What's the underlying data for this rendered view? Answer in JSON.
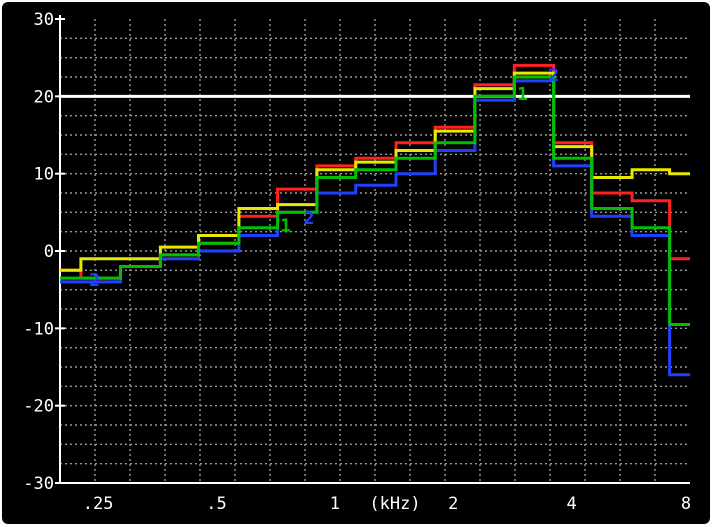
{
  "chart_data": {
    "type": "line",
    "step": true,
    "x_scale": "log2",
    "xlim": [
      0.2,
      8
    ],
    "ylim": [
      -30,
      30
    ],
    "grid": true,
    "background": "#000000",
    "xlabel": "(kHz)",
    "x_ticks": [
      {
        "value": 0.25,
        "label": ".25"
      },
      {
        "value": 0.5,
        "label": ".5"
      },
      {
        "value": 1,
        "label": "1"
      },
      {
        "value": 2,
        "label": "2"
      },
      {
        "value": 4,
        "label": "4"
      },
      {
        "value": 8,
        "label": "8"
      }
    ],
    "y_ticks": [
      {
        "value": 30,
        "label": "30"
      },
      {
        "value": 20,
        "label": "20"
      },
      {
        "value": 10,
        "label": "10"
      },
      {
        "value": 0,
        "label": "0"
      },
      {
        "value": -10,
        "label": "-10"
      },
      {
        "value": -20,
        "label": "-20"
      },
      {
        "value": -30,
        "label": "-30"
      }
    ],
    "reference_line": {
      "y": 20,
      "color": "#ffffff"
    },
    "x_edges": [
      0.2,
      0.226,
      0.285,
      0.36,
      0.45,
      0.57,
      0.715,
      0.9,
      1.13,
      1.43,
      1.8,
      2.27,
      2.86,
      3.6,
      4.5,
      5.7,
      7.1,
      8
    ],
    "series": [
      {
        "color": "#ff2020",
        "values": [
          -2.5,
          -3.5,
          -2,
          -0.5,
          1,
          4.5,
          8,
          11,
          12,
          14,
          16,
          21.5,
          24,
          14,
          7.5,
          6.5,
          -1
        ]
      },
      {
        "color": "#e8e800",
        "values": [
          -2.5,
          -1,
          -1,
          0.5,
          2,
          5.5,
          6,
          10.5,
          11.5,
          13,
          15.5,
          21,
          23,
          13.5,
          9.5,
          10.5,
          10
        ]
      },
      {
        "color": "#2040ff",
        "values": [
          -4,
          -4,
          -2,
          -1,
          0,
          2,
          5,
          7.5,
          8.5,
          10,
          13,
          19.5,
          22,
          11,
          4.5,
          2,
          -16
        ]
      },
      {
        "color": "#00c000",
        "values": [
          -3.5,
          -3.5,
          -2,
          -0.5,
          1,
          3,
          5,
          9.5,
          10.5,
          12,
          14,
          20,
          22.5,
          12,
          5.5,
          3,
          -9.5
        ]
      }
    ],
    "markers": [
      {
        "text": "2",
        "x": 0.245,
        "y": -4.5,
        "color": "#2040ff"
      },
      {
        "text": "1",
        "x": 0.75,
        "y": 2.5,
        "color": "#00c000"
      },
      {
        "text": "2",
        "x": 0.86,
        "y": 3.5,
        "color": "#2040ff"
      },
      {
        "text": "1",
        "x": 3.0,
        "y": 19.5,
        "color": "#00c000"
      },
      {
        "text": "2",
        "x": 3.6,
        "y": 22,
        "color": "#2040ff"
      }
    ]
  }
}
